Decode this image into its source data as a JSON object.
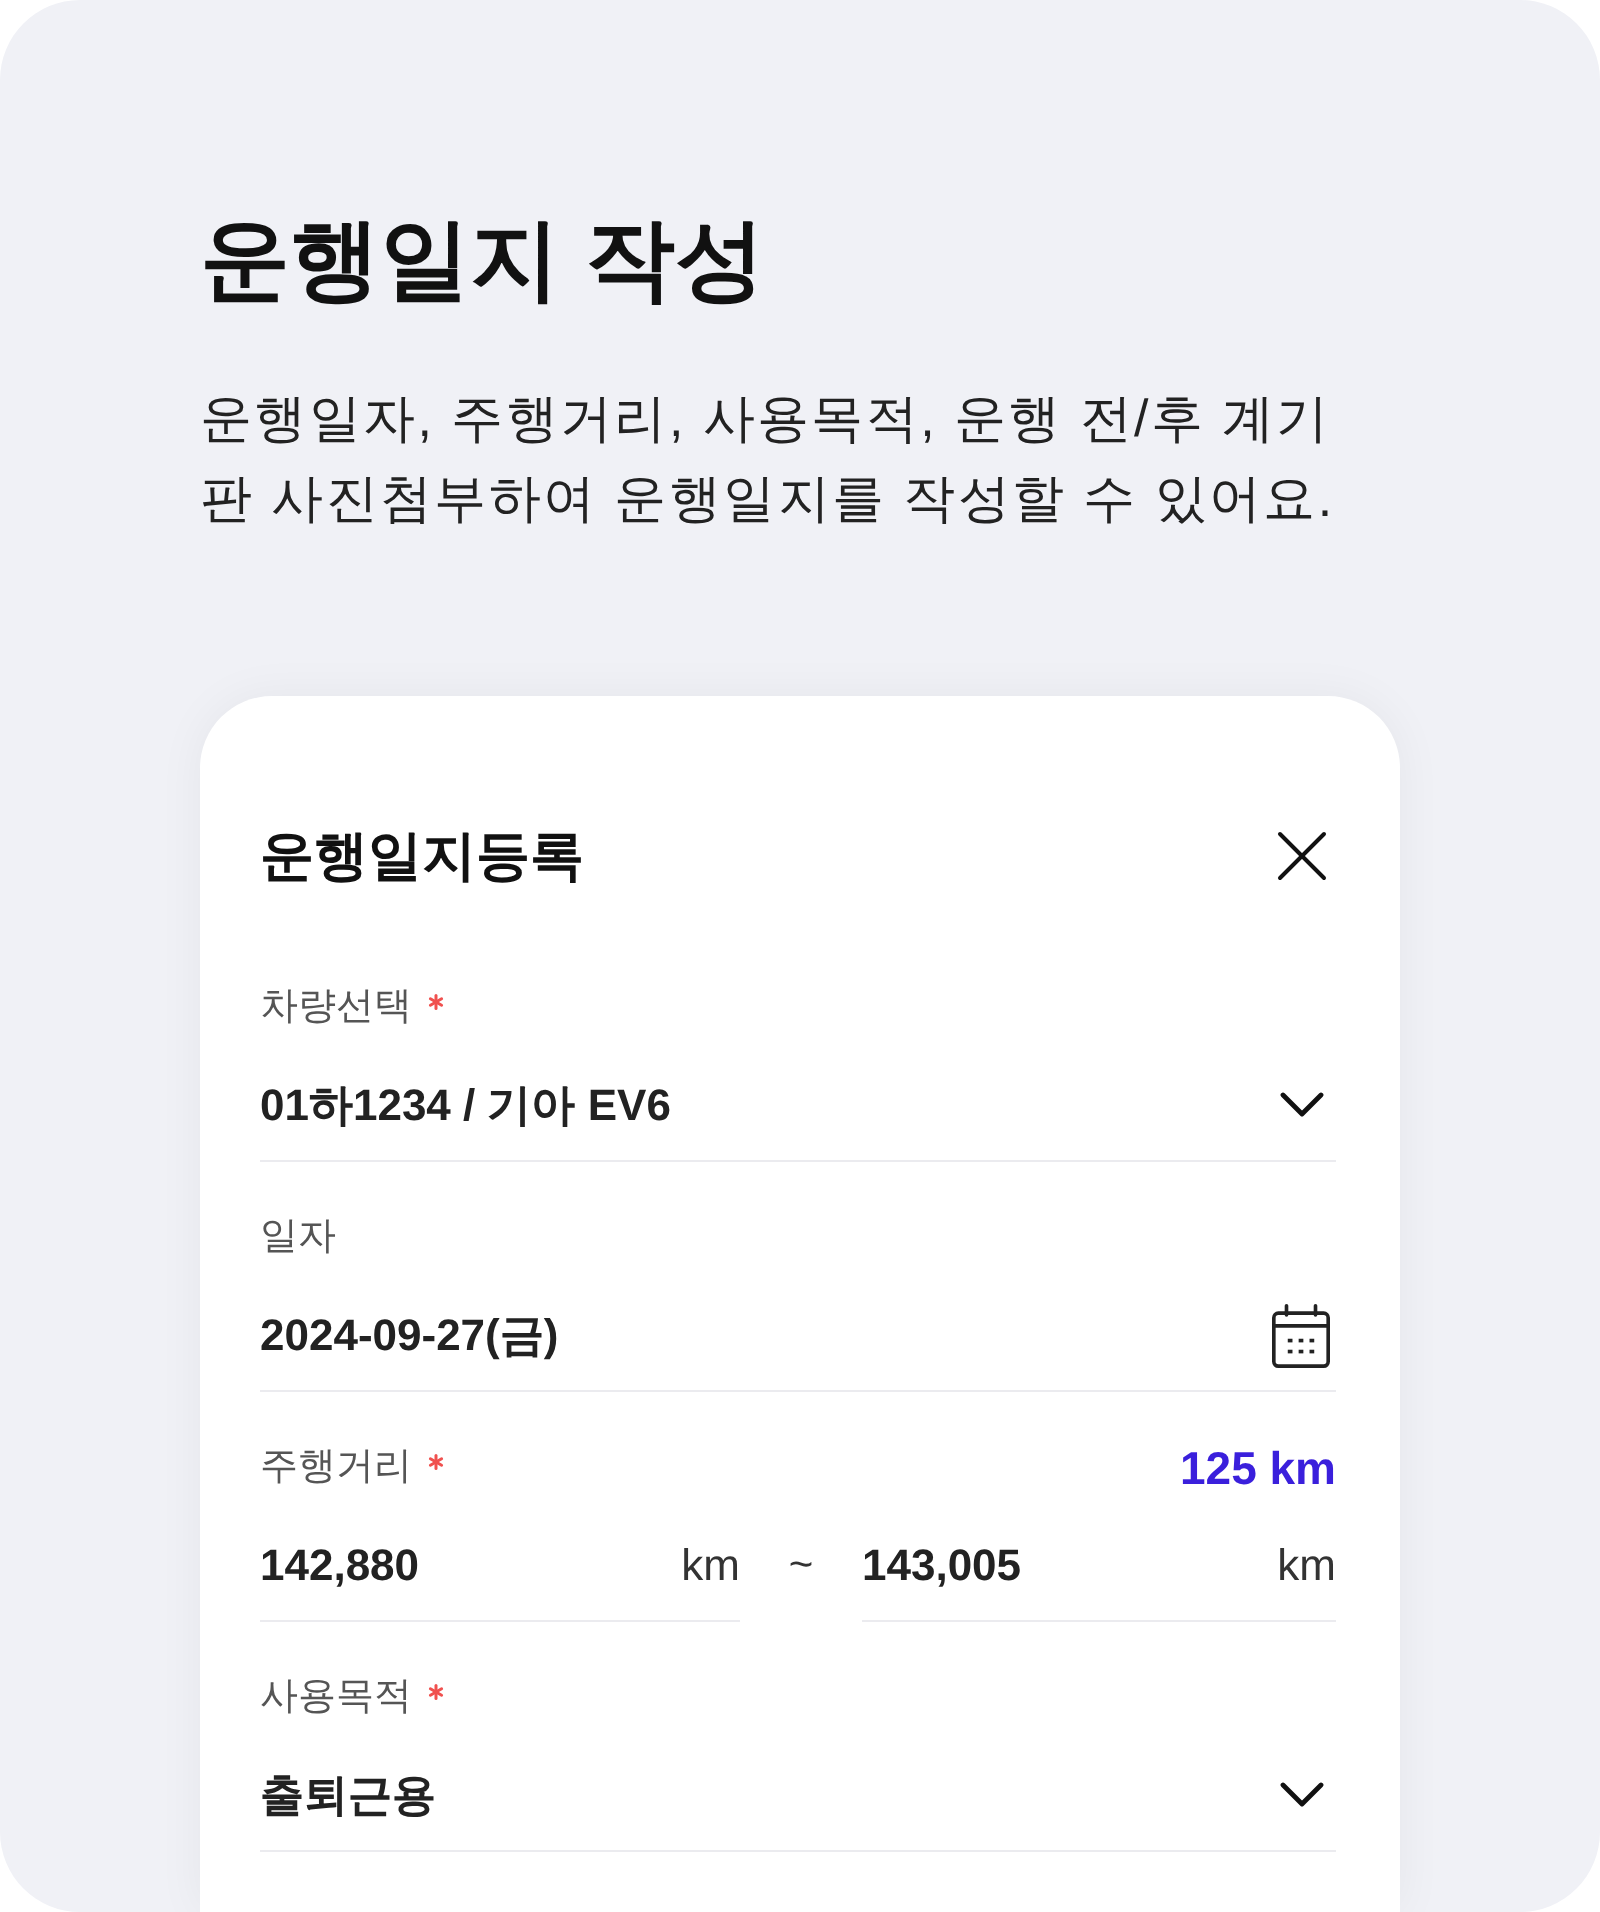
{
  "intro": {
    "title": "운행일지 작성",
    "description": "운행일자, 주행거리, 사용목적, 운행 전/후 계기판 사진첨부하여 운행일지를 작성할 수 있어요."
  },
  "dialog": {
    "title": "운행일지등록",
    "fields": [
      {
        "kind": "select",
        "label": "차량선택",
        "required": true,
        "value": "01하1234 / 기아 EV6"
      },
      {
        "kind": "date",
        "label": "일자",
        "required": false,
        "value": "2024-09-27(금)"
      },
      {
        "kind": "range",
        "label": "주행거리",
        "required": true,
        "total": "125 km",
        "from": {
          "value": "142,880",
          "unit": "km"
        },
        "separator": "~",
        "to": {
          "value": "143,005",
          "unit": "km"
        }
      },
      {
        "kind": "select",
        "label": "사용목적",
        "required": true,
        "value": "출퇴근용"
      }
    ]
  }
}
